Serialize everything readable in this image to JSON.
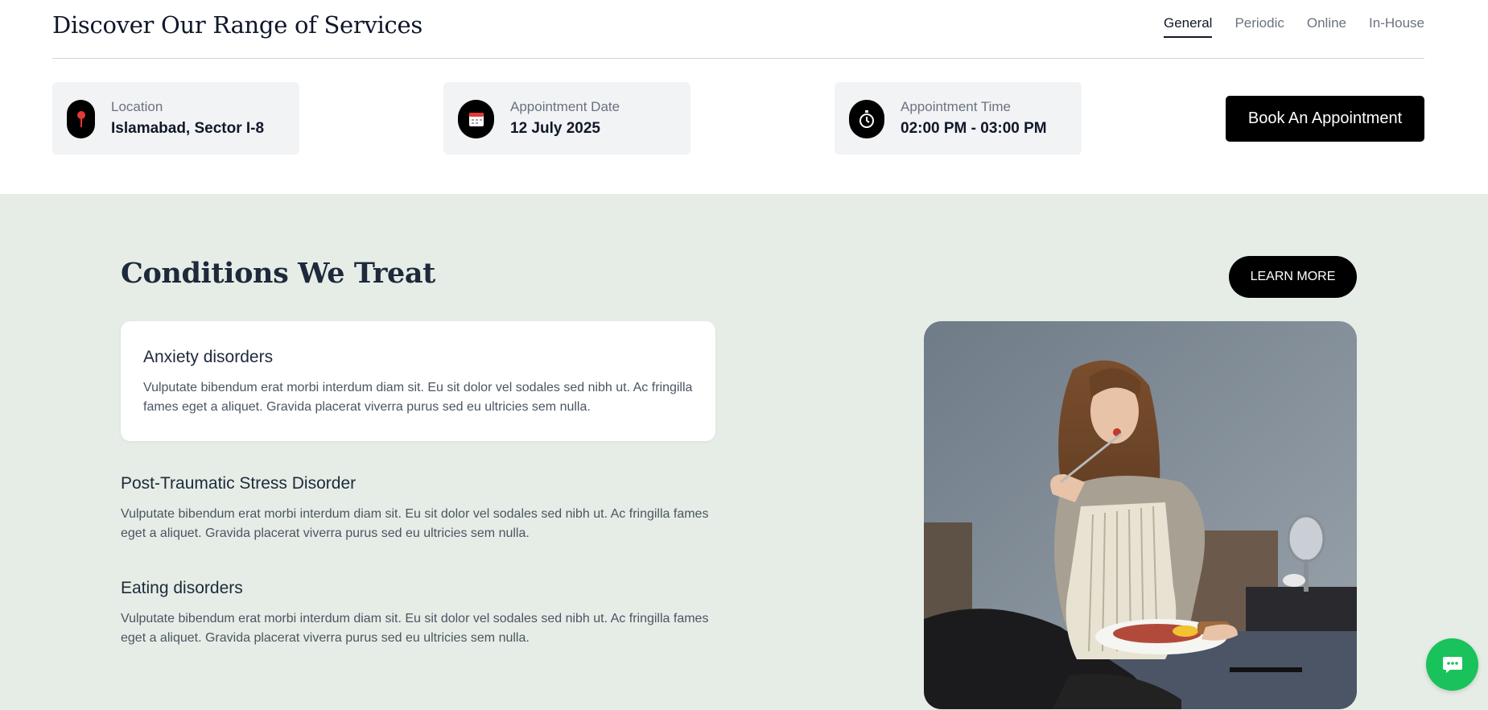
{
  "header": {
    "title": "Discover Our Range of Services",
    "tabs": [
      {
        "label": "General",
        "active": true
      },
      {
        "label": "Periodic",
        "active": false
      },
      {
        "label": "Online",
        "active": false
      },
      {
        "label": "In-House",
        "active": false
      }
    ]
  },
  "booking": {
    "location": {
      "label": "Location",
      "value": "Islamabad, Sector I-8",
      "icon": "map-pin-icon"
    },
    "date": {
      "label": "Appointment Date",
      "value": "12 July 2025",
      "icon": "calendar-icon"
    },
    "time": {
      "label": "Appointment Time",
      "value": "02:00 PM - 03:00 PM",
      "icon": "stopwatch-icon"
    },
    "book_label": "Book An Appointment"
  },
  "conditions": {
    "title": "Conditions We Treat",
    "learn_more_label": "LEARN MORE",
    "items": [
      {
        "title": "Anxiety disorders",
        "description": "Vulputate bibendum erat morbi interdum diam sit. Eu sit dolor vel sodales sed nibh ut. Ac fringilla fames eget a aliquet. Gravida placerat viverra purus sed eu ultricies sem nulla.",
        "highlighted": true
      },
      {
        "title": "Post-Traumatic Stress Disorder",
        "description": "Vulputate bibendum erat morbi interdum diam sit. Eu sit dolor vel sodales sed nibh ut. Ac fringilla fames eget a aliquet. Gravida placerat viverra purus sed eu ultricies sem nulla.",
        "highlighted": false
      },
      {
        "title": "Eating disorders",
        "description": "Vulputate bibendum erat morbi interdum diam sit. Eu sit dolor vel sodales sed nibh ut. Ac fringilla fames eget a aliquet. Gravida placerat viverra purus sed eu ultricies sem nulla.",
        "highlighted": false
      }
    ]
  },
  "chat": {
    "icon": "chat-bubble-icon",
    "color": "#19c25a"
  },
  "colors": {
    "accent": "#000000",
    "section_bg": "#e5ede6",
    "card_bg": "#f1f3f5"
  }
}
